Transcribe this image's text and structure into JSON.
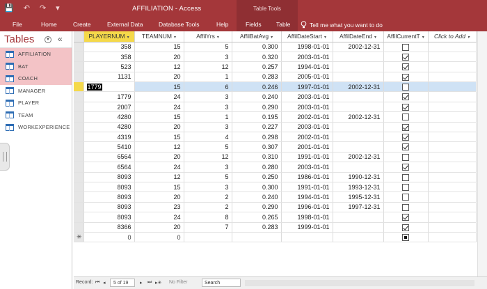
{
  "titlebar": {
    "title": "AFFILIATION  -  Access",
    "context_tab_header": "Table Tools",
    "qat": {
      "save": "💾",
      "undo": "↶",
      "redo": "↷",
      "customize": "▾"
    }
  },
  "ribbon": {
    "tabs": [
      "File",
      "Home",
      "Create",
      "External Data",
      "Database Tools",
      "Help",
      "Fields",
      "Table"
    ],
    "tell_me": "Tell me what you want to do"
  },
  "nav": {
    "title": "Tables",
    "dropdown_glyph": "▼",
    "collapse_glyph": "«",
    "items": [
      {
        "label": "AFFILIATION",
        "selected": true
      },
      {
        "label": "BAT",
        "selected": true
      },
      {
        "label": "COACH",
        "selected": true
      },
      {
        "label": "MANAGER",
        "selected": false
      },
      {
        "label": "PLAYER",
        "selected": false
      },
      {
        "label": "TEAM",
        "selected": false
      },
      {
        "label": "WORKEXPERIENCE",
        "selected": false
      }
    ]
  },
  "grid": {
    "sort_arrow": "▾",
    "new_row_marker": "✳",
    "columns": [
      "PLAYERNUM",
      "TEAMNUM",
      "AffilYrs",
      "AffilBatAvg",
      "AffilDateStart",
      "AffilDateEnd",
      "AffilCurrentT",
      "Click to Add"
    ],
    "rows": [
      {
        "p": "358",
        "t": "15",
        "y": "5",
        "avg": "0.300",
        "start": "1998-01-01",
        "end": "2002-12-31",
        "cur": false
      },
      {
        "p": "358",
        "t": "20",
        "y": "3",
        "avg": "0.320",
        "start": "2003-01-01",
        "end": "",
        "cur": true
      },
      {
        "p": "523",
        "t": "12",
        "y": "12",
        "avg": "0.257",
        "start": "1994-01-01",
        "end": "",
        "cur": true
      },
      {
        "p": "1131",
        "t": "20",
        "y": "1",
        "avg": "0.283",
        "start": "2005-01-01",
        "end": "",
        "cur": true
      },
      {
        "p": "1779",
        "t": "15",
        "y": "6",
        "avg": "0.246",
        "start": "1997-01-01",
        "end": "2002-12-31",
        "cur": false
      },
      {
        "p": "1779",
        "t": "24",
        "y": "3",
        "avg": "0.240",
        "start": "2003-01-01",
        "end": "",
        "cur": true
      },
      {
        "p": "2007",
        "t": "24",
        "y": "3",
        "avg": "0.290",
        "start": "2003-01-01",
        "end": "",
        "cur": true
      },
      {
        "p": "4280",
        "t": "15",
        "y": "1",
        "avg": "0.195",
        "start": "2002-01-01",
        "end": "2002-12-31",
        "cur": false
      },
      {
        "p": "4280",
        "t": "20",
        "y": "3",
        "avg": "0.227",
        "start": "2003-01-01",
        "end": "",
        "cur": true
      },
      {
        "p": "4319",
        "t": "15",
        "y": "4",
        "avg": "0.298",
        "start": "2002-01-01",
        "end": "",
        "cur": true
      },
      {
        "p": "5410",
        "t": "12",
        "y": "5",
        "avg": "0.307",
        "start": "2001-01-01",
        "end": "",
        "cur": true
      },
      {
        "p": "6564",
        "t": "20",
        "y": "12",
        "avg": "0.310",
        "start": "1991-01-01",
        "end": "2002-12-31",
        "cur": false
      },
      {
        "p": "6564",
        "t": "24",
        "y": "3",
        "avg": "0.280",
        "start": "2003-01-01",
        "end": "",
        "cur": true
      },
      {
        "p": "8093",
        "t": "12",
        "y": "5",
        "avg": "0.250",
        "start": "1986-01-01",
        "end": "1990-12-31",
        "cur": false
      },
      {
        "p": "8093",
        "t": "15",
        "y": "3",
        "avg": "0.300",
        "start": "1991-01-01",
        "end": "1993-12-31",
        "cur": false
      },
      {
        "p": "8093",
        "t": "20",
        "y": "2",
        "avg": "0.240",
        "start": "1994-01-01",
        "end": "1995-12-31",
        "cur": false
      },
      {
        "p": "8093",
        "t": "23",
        "y": "2",
        "avg": "0.290",
        "start": "1996-01-01",
        "end": "1997-12-31",
        "cur": false
      },
      {
        "p": "8093",
        "t": "24",
        "y": "8",
        "avg": "0.265",
        "start": "1998-01-01",
        "end": "",
        "cur": true
      },
      {
        "p": "8366",
        "t": "20",
        "y": "7",
        "avg": "0.283",
        "start": "1999-01-01",
        "end": "",
        "cur": true
      }
    ],
    "current_row_index": 4,
    "new_row": {
      "p": "0",
      "t": "0"
    }
  },
  "status": {
    "record_label": "Record:",
    "nav_first": "⏮",
    "nav_prev": "◂",
    "record_position": "5 of 19",
    "nav_next": "▸",
    "nav_last": "⏭",
    "nav_new": "▸✳",
    "filter": "No Filter",
    "search_placeholder": "Search"
  }
}
